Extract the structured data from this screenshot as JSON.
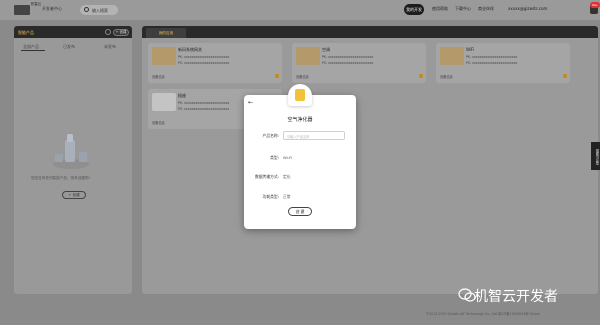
{
  "topbar": {
    "logo_text": "机智云",
    "dev_center": "开发者中心",
    "search_placeholder": "输入搜索",
    "nav": [
      "我的开发",
      "使用帮助",
      "下载中心",
      "商业伙伴"
    ],
    "active_nav": "我的开发",
    "email": "xxxxx@gizwits.com",
    "badge": "99+"
  },
  "left_panel": {
    "title": "智能产品",
    "add_label": "+ 创建",
    "tabs": [
      "全部产品",
      "已发布",
      "未发布"
    ],
    "empty_text": "您还没有任何智能产品，快来创建吧!",
    "create_button": "+ 创建"
  },
  "main_panel": {
    "tab": "我的应用",
    "cards": [
      {
        "title": "新风系统网关",
        "l1": "PK: xxxxxxxxxxxxxxxxxxxxxxxx",
        "l2": "PS: xxxxxxxxxxxxxxxxxxxxxxxx",
        "foot": "设备信息"
      },
      {
        "title": "空调",
        "l1": "PK: xxxxxxxxxxxxxxxxxxxxxxxx",
        "l2": "PS: xxxxxxxxxxxxxxxxxxxxxxxx",
        "foot": "设备信息"
      },
      {
        "title": "WiFi",
        "l1": "PK: xxxxxxxxxxxxxxxxxxxxxxxx",
        "l2": "PS: xxxxxxxxxxxxxxxxxxxxxxxx",
        "foot": "设备信息"
      },
      {
        "title": "插座",
        "l1": "PK: xxxxxxxxxxxxxxxxxxxxxxxx",
        "l2": "PS: xxxxxxxxxxxxxxxxxxxxxxxx",
        "foot": "设备信息"
      }
    ]
  },
  "modal": {
    "title": "空气净化器",
    "name_label": "产品名称:",
    "name_placeholder": "请输入产品名称",
    "type_label": "类型:",
    "type_value": "Wi-Fi",
    "transfer_label": "数据传输方式:",
    "transfer_value": "定长",
    "func_label": "功耗类型:",
    "func_value": "正常",
    "confirm_label": "创 建"
  },
  "side_tab": "帮助与反馈",
  "footer": "©2013-2020 Gizwits IoT Technology Co., Ltd 粤ICP备13026518号 Unipin",
  "watermark": "机智云开发者"
}
